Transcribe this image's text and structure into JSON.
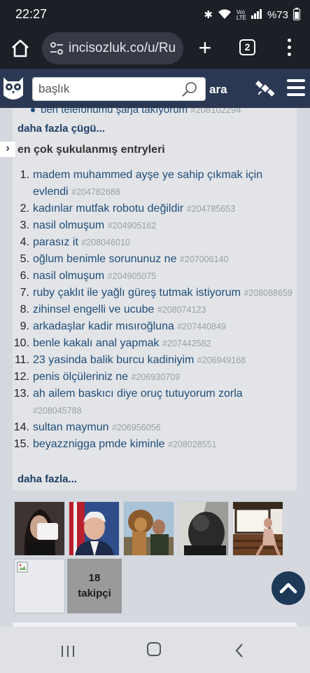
{
  "status_bar": {
    "time": "22:27",
    "battery": "%73"
  },
  "browser": {
    "url": "incisozluk.co/u/Ru",
    "tab_count": "2"
  },
  "header": {
    "search_placeholder": "başlık",
    "search_button": "ara"
  },
  "page": {
    "previous_item": {
      "title": "ben telefonumu şarja takıyorum",
      "id": "#208102294"
    },
    "previous_more": "daha fazla çügü...",
    "section_title": "en çok şukulanmış entryleri",
    "entries": [
      {
        "num": "1.",
        "title": "madem muhammed ayşe ye sahip çıkmak için evlendi",
        "id": "#204782688"
      },
      {
        "num": "2.",
        "title": "kadınlar mutfak robotu değildir",
        "id": "#204785653"
      },
      {
        "num": "3.",
        "title": "nasil olmuşum",
        "id": "#204905162"
      },
      {
        "num": "4.",
        "title": "parasız it",
        "id": "#208046010"
      },
      {
        "num": "5.",
        "title": "oğlum benimle sorununuz ne",
        "id": "#207006140"
      },
      {
        "num": "6.",
        "title": "nasil olmuşum",
        "id": "#204905075"
      },
      {
        "num": "7.",
        "title": "ruby çaklıt ile yağlı güreş tutmak istiyorum",
        "id": "#208088659"
      },
      {
        "num": "8.",
        "title": "zihinsel engelli ve ucube",
        "id": "#208074123"
      },
      {
        "num": "9.",
        "title": "arkadaşlar kadir mısıroğluna",
        "id": "#207440849"
      },
      {
        "num": "10.",
        "title": "benle kakalı anal yapmak",
        "id": "#207442582"
      },
      {
        "num": "11.",
        "title": "23 yasinda balik burcu kadiniyim",
        "id": "#206949168"
      },
      {
        "num": "12.",
        "title": "penis ölçüleriniz ne",
        "id": "#206930709"
      },
      {
        "num": "13.",
        "title": "ah ailem baskıcı diye oruç tutuyorum zorla",
        "id": "#208045788"
      },
      {
        "num": "14.",
        "title": "sultan maymun",
        "id": "#206956056"
      },
      {
        "num": "15.",
        "title": "beyazznigga pmde kiminle",
        "id": "#208028551"
      }
    ],
    "more_link": "daha fazla...",
    "followers": {
      "count": "18",
      "label": "takipçi"
    }
  }
}
